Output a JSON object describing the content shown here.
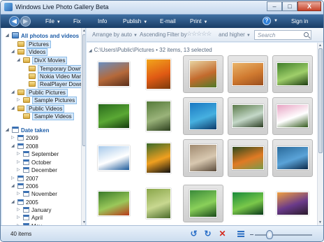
{
  "window": {
    "title": "Windows Live Photo Gallery Beta",
    "buttons": {
      "minimize": "–",
      "maximize": "□",
      "close": "X"
    }
  },
  "menubar": {
    "items": [
      {
        "label": "File",
        "arrow": "▼"
      },
      {
        "label": "Fix",
        "arrow": ""
      },
      {
        "label": "Info",
        "arrow": ""
      },
      {
        "label": "Publish",
        "arrow": "▼"
      },
      {
        "label": "E-mail",
        "arrow": ""
      },
      {
        "label": "Print",
        "arrow": "▼"
      }
    ],
    "help_glyph": "?",
    "help_arrow": "▼",
    "sign_in": "Sign in",
    "nav": {
      "back_glyph": "◀",
      "forward_glyph": "▶"
    }
  },
  "sidebar": {
    "scroll": {
      "up": "▲",
      "down": "▼"
    },
    "tree": [
      {
        "label": "All photos and videos",
        "type": "header-photos",
        "expander": "◢"
      },
      {
        "label": "Pictures",
        "type": "folder",
        "selected": true,
        "expander": ""
      },
      {
        "label": "Videos",
        "type": "folder",
        "selected": true,
        "expander": "◢"
      },
      {
        "label": "DivX Movies",
        "type": "folder",
        "selected": true,
        "expander": "◢"
      },
      {
        "label": "Temporary Downloads",
        "type": "folder",
        "selected": true,
        "expander": ""
      },
      {
        "label": "Nokia Video Manager",
        "type": "folder",
        "selected": true,
        "expander": ""
      },
      {
        "label": "RealPlayer Downloads",
        "type": "folder",
        "selected": true,
        "expander": ""
      },
      {
        "label": "Public Pictures",
        "type": "folder",
        "selected": true,
        "expander": "◢"
      },
      {
        "label": "Sample Pictures",
        "type": "folder",
        "selected": true,
        "expander": "▷"
      },
      {
        "label": "Public Videos",
        "type": "folder",
        "selected": true,
        "expander": "◢"
      },
      {
        "label": "Sample Videos",
        "type": "folder",
        "selected": true,
        "expander": ""
      },
      {
        "label": "Date taken",
        "type": "header-date",
        "expander": "◢"
      },
      {
        "label": "2009",
        "type": "cal",
        "expander": "▷"
      },
      {
        "label": "2008",
        "type": "cal",
        "expander": "◢"
      },
      {
        "label": "September",
        "type": "cal",
        "expander": "▷"
      },
      {
        "label": "October",
        "type": "cal",
        "expander": "▷"
      },
      {
        "label": "December",
        "type": "cal",
        "expander": "▷"
      },
      {
        "label": "2007",
        "type": "cal",
        "expander": "▷"
      },
      {
        "label": "2006",
        "type": "cal",
        "expander": "◢"
      },
      {
        "label": "November",
        "type": "cal",
        "expander": "▷"
      },
      {
        "label": "2005",
        "type": "cal",
        "expander": "◢"
      },
      {
        "label": "January",
        "type": "cal",
        "expander": "▷"
      },
      {
        "label": "April",
        "type": "cal",
        "expander": "▷"
      },
      {
        "label": "May",
        "type": "cal",
        "expander": "▷"
      }
    ]
  },
  "filterbar": {
    "arrange": "Arrange by auto",
    "arrange_arrow": "▼",
    "ascending": "Ascending",
    "filter_by": "Filter by",
    "stars": "☆☆☆☆☆",
    "and_higher": "and higher",
    "and_higher_arrow": "▼",
    "search_placeholder": "Search"
  },
  "content": {
    "path": "C:\\Users\\Public\\Pictures • 32 items, 13 selected",
    "path_expander": "◢",
    "scroll": {
      "up": "▲",
      "down": "▼"
    },
    "thumbnails": [
      {
        "name": "desert-buttes",
        "selected": false,
        "colors": [
          "#6a8fc0",
          "#b5693a",
          "#5a2f1a"
        ]
      },
      {
        "name": "orange-flowers",
        "selected": false,
        "colors": [
          "#f2a51c",
          "#e05a14",
          "#7a3a0c"
        ]
      },
      {
        "name": "abstract-painting",
        "selected": true,
        "colors": [
          "#e8d3a0",
          "#c36a2d",
          "#4f7a2a"
        ]
      },
      {
        "name": "desert-oryx",
        "selected": true,
        "colors": [
          "#e9b46a",
          "#d07a30",
          "#9a4e1e"
        ]
      },
      {
        "name": "forest-path",
        "selected": true,
        "colors": [
          "#3f7d2a",
          "#9fcf6a",
          "#1e3d12"
        ]
      },
      {
        "name": "green-leaves",
        "selected": false,
        "colors": [
          "#2a6a1d",
          "#5aa834",
          "#143a0c"
        ]
      },
      {
        "name": "fern-waterfall",
        "selected": false,
        "colors": [
          "#557a3a",
          "#9ab37a",
          "#2c3f1e"
        ]
      },
      {
        "name": "sea-turtle",
        "selected": true,
        "colors": [
          "#1a78c2",
          "#46b0e0",
          "#0c3a6a"
        ]
      },
      {
        "name": "forest-stream",
        "selected": true,
        "colors": [
          "#5b7a4a",
          "#c4d8c8",
          "#2d3f24"
        ]
      },
      {
        "name": "pink-blossoms",
        "selected": true,
        "colors": [
          "#e7a3c3",
          "#ffffff",
          "#345a1e"
        ]
      },
      {
        "name": "iceberg-sea",
        "selected": false,
        "colors": [
          "#a7c9ea",
          "#ffffff",
          "#1c5a9a"
        ]
      },
      {
        "name": "toucan-bird",
        "selected": false,
        "colors": [
          "#3a6a2a",
          "#f0a020",
          "#101010"
        ]
      },
      {
        "name": "forest-ruin",
        "selected": true,
        "colors": [
          "#a08a70",
          "#d8c8b0",
          "#5a4a3a"
        ]
      },
      {
        "name": "garden-orange",
        "selected": true,
        "colors": [
          "#2c4a1c",
          "#e07a24",
          "#7a9a4a"
        ]
      },
      {
        "name": "whale-tail",
        "selected": true,
        "colors": [
          "#2a6a9a",
          "#5aa3d8",
          "#0c2a4a"
        ]
      },
      {
        "name": "frog-leaves",
        "selected": false,
        "colors": [
          "#3a7a2a",
          "#9ac85a",
          "#b83a1a"
        ]
      },
      {
        "name": "moss-field",
        "selected": false,
        "colors": [
          "#8aa64a",
          "#c8d890",
          "#4a6a2a"
        ]
      },
      {
        "name": "green-plant",
        "selected": true,
        "colors": [
          "#3a8a3a",
          "#8ad05a",
          "#1a4a1a"
        ]
      },
      {
        "name": "dewdrops-leaf",
        "selected": false,
        "colors": [
          "#1a8a3a",
          "#7ac84a",
          "#0a3a1a"
        ]
      },
      {
        "name": "stonehenge",
        "selected": false,
        "colors": [
          "#f0a040",
          "#6a3a8a",
          "#2a1a2a"
        ]
      }
    ]
  },
  "statusbar": {
    "count": "40 items",
    "rotate_ccw": "↺",
    "rotate_cw": "↻",
    "delete": "✕",
    "zoom": 0.26
  }
}
